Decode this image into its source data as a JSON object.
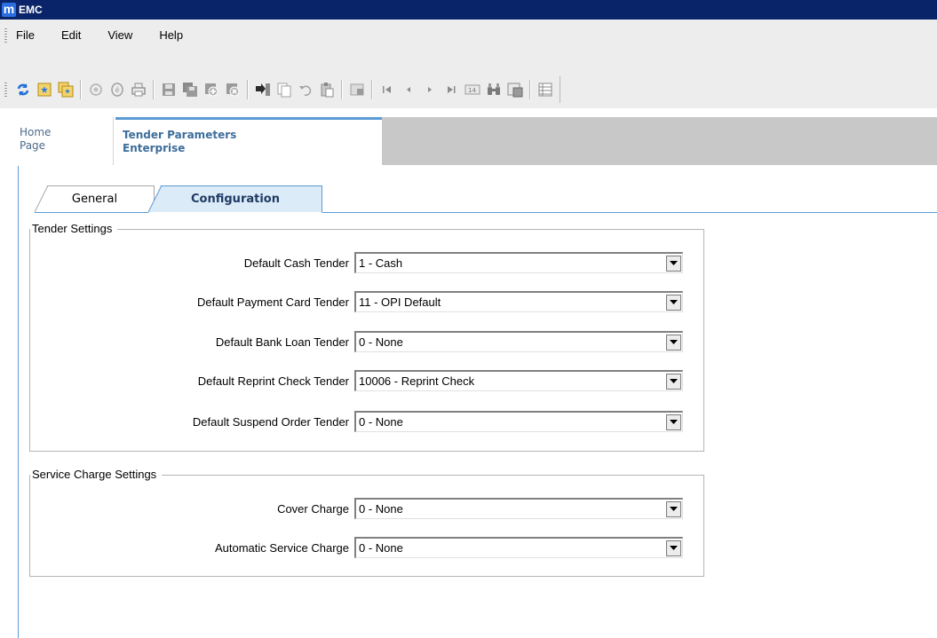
{
  "app": {
    "logo_letter": "m",
    "title": "EMC"
  },
  "menu": [
    "File",
    "Edit",
    "View",
    "Help"
  ],
  "toolbar": {
    "icons": [
      "refresh-icon",
      "open-icon",
      "open-multiple-icon",
      "record-icon",
      "document-icon",
      "print-icon",
      "save-icon",
      "save-all-icon",
      "add-icon",
      "delete-icon",
      "import-icon",
      "copy-icon",
      "undo-icon",
      "paste-icon",
      "grid-icon",
      "first-record-icon",
      "previous-record-icon",
      "next-record-icon",
      "last-record-icon",
      "go-to-record-icon",
      "find-icon",
      "view-icon",
      "table-icon"
    ]
  },
  "page_tabs": {
    "home": {
      "line1": "Home",
      "line2": "Page"
    },
    "active": {
      "line1": "Tender Parameters",
      "line2": "Enterprise"
    }
  },
  "tabs": {
    "general": "General",
    "configuration": "Configuration"
  },
  "tender_settings": {
    "title": "Tender Settings",
    "rows": [
      {
        "label": "Default Cash Tender",
        "value": "1 - Cash"
      },
      {
        "label": "Default Payment Card Tender",
        "value": "11 - OPI Default"
      },
      {
        "label": "Default Bank Loan Tender",
        "value": "0 - None"
      },
      {
        "label": "Default Reprint Check Tender",
        "value": "10006 - Reprint Check"
      },
      {
        "label": "Default Suspend Order Tender",
        "value": "0 - None"
      }
    ]
  },
  "service_charge_settings": {
    "title": "Service Charge Settings",
    "rows": [
      {
        "label": "Cover Charge",
        "value": "0 - None"
      },
      {
        "label": "Automatic Service Charge",
        "value": "0 - None"
      }
    ]
  },
  "colors": {
    "titlebar": "#0a246a",
    "accent": "#5b9bd5",
    "active_tab": "#dcebf8"
  }
}
